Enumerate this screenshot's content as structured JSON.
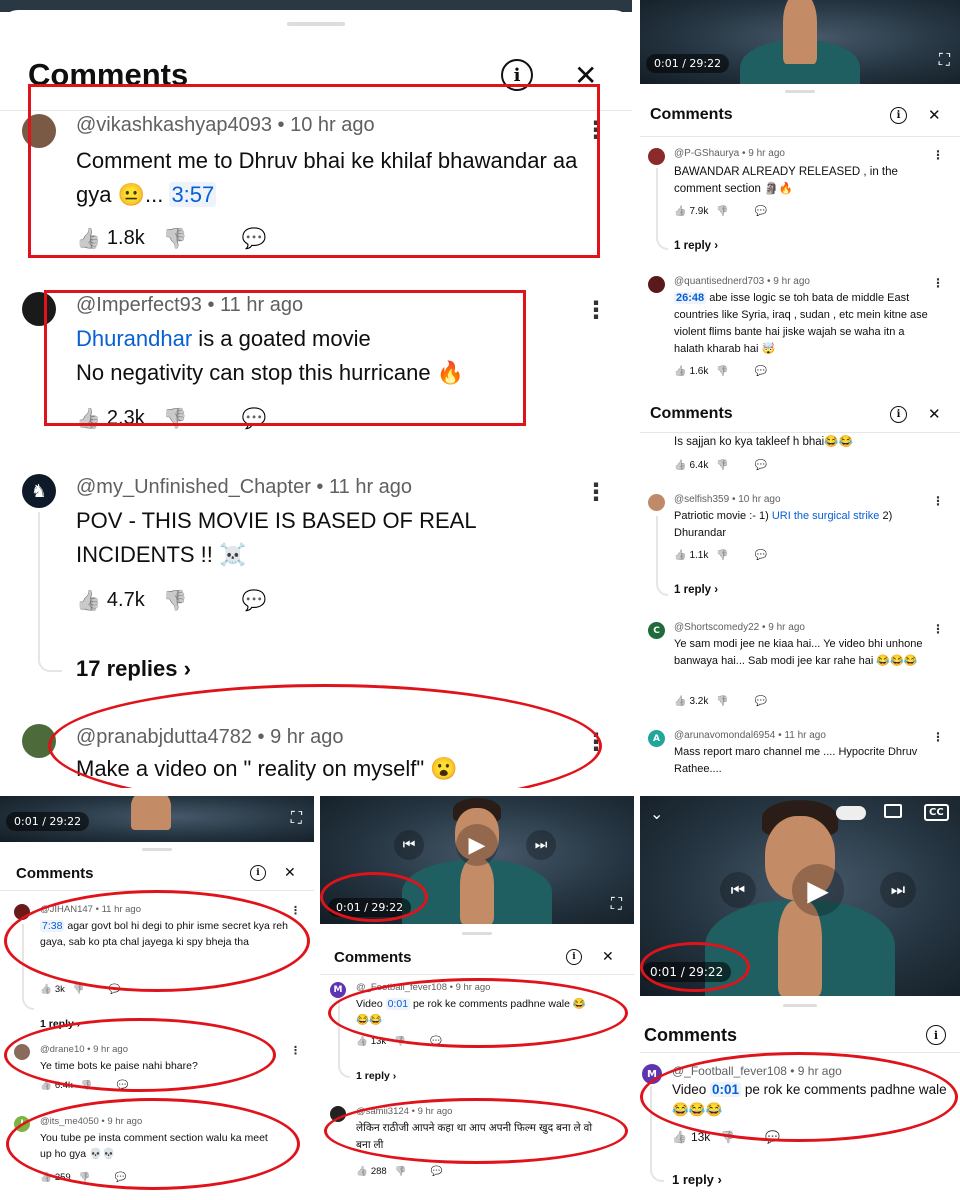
{
  "panel1": {
    "title": "Comments",
    "comments": [
      {
        "handle": "@vikashkashyap4093",
        "time": "10 hr ago",
        "text": "Comment me to Dhruv bhai ke khilaf bhawandar aa gya 😐...",
        "timestamp": "3:57",
        "likes": "1.8k"
      },
      {
        "handle": "@Imperfect93",
        "time": "11 hr ago",
        "link": "Dhurandhar",
        "text1": " is a goated movie",
        "text2": "No negativity can stop this hurricane 🔥",
        "likes": "2.3k"
      },
      {
        "handle": "@my_Unfinished_Chapter",
        "time": "11 hr ago",
        "text": "POV - THIS MOVIE IS BASED OF REAL INCIDENTS !! ☠️",
        "likes": "4.7k",
        "replies": "17 replies"
      },
      {
        "handle": "@pranabjdutta4782",
        "time": "9 hr ago",
        "text": "Make a video on \" reality on myself\" 😮"
      }
    ]
  },
  "panel2": {
    "time": "0:01 / 29:22",
    "title": "Comments",
    "comments": [
      {
        "handle": "@P-GShaurya",
        "time": "9 hr ago",
        "text": "BAWANDAR ALREADY RELEASED , in the comment section 🗿🔥",
        "likes": "7.9k",
        "reply": "1 reply"
      },
      {
        "handle": "@quantisednerd703",
        "time": "9 hr ago",
        "timestamp": "26:48",
        "text": " abe isse logic se toh bata de middle East countries like Syria, iraq , sudan , etc mein kitne ase violent flims bante hai jiske wajah se waha itn a halath kharab hai 🤯",
        "likes": "1.6k"
      }
    ]
  },
  "panel3": {
    "title": "Comments",
    "comments": [
      {
        "handle": "",
        "time": "",
        "text": "Is sajjan ko kya takleef h bhai😂😂",
        "likes": "6.4k"
      },
      {
        "handle": "@selfish359",
        "time": "10 hr ago",
        "text1": "Patriotic movie :- 1) ",
        "link": "URI the surgical strike",
        "text2": " 2) Dhurandar",
        "likes": "1.1k",
        "reply": "1 reply"
      },
      {
        "handle": "@Shortscomedy22",
        "time": "9 hr ago",
        "avatar": "C",
        "text": "Ye sam modi jee ne kiaa hai... Ye video bhi unhone banwaya hai... Sab modi jee kar rahe hai 😂😂😂",
        "likes": "3.2k"
      },
      {
        "handle": "@arunavomondal6954",
        "time": "11 hr ago",
        "avatar": "A",
        "text": "Mass report maro channel me .... Hypocrite Dhruv Rathee...."
      }
    ]
  },
  "panel4": {
    "time": "0:01 / 29:22",
    "title": "Comments",
    "comments": [
      {
        "handle": "@JIHAN147",
        "time": "11 hr ago",
        "timestamp": "7:38",
        "text": " agar govt bol hi degi to phir isme secret kya reh gaya, sab ko pta chal jayega ki spy bheja tha",
        "likes": "3k",
        "reply": "1 reply"
      },
      {
        "handle": "@drane10",
        "time": "9 hr ago",
        "text": "Ye time bots ke paise nahi bhare?",
        "likes": "6.4k"
      },
      {
        "handle": "@its_me4050",
        "time": "9 hr ago",
        "avatar": "I",
        "text": "You tube pe insta comment section walu ka meet up ho gya 💀💀",
        "likes": "259"
      }
    ]
  },
  "panel5": {
    "time": "0:01 / 29:22",
    "title": "Comments",
    "comments": [
      {
        "handle": "@_Football_fever108",
        "time": "9 hr ago",
        "avatar": "M",
        "text1": "Video ",
        "timestamp": "0:01",
        "text2": " pe rok ke comments padhne wale 😂😂😂",
        "likes": "13k",
        "reply": "1 reply"
      },
      {
        "handle": "@samii3124",
        "time": "9 hr ago",
        "text": "लेकिन राठीजी आपने कहा था आप अपनी फिल्म खुद बना ले वो बना ली",
        "likes": "288"
      }
    ]
  },
  "panel6": {
    "time": "0:01 / 29:22",
    "title": "Comments",
    "comments": [
      {
        "handle": "@_Football_fever108",
        "time": "9 hr ago",
        "avatar": "M",
        "text1": "Video ",
        "timestamp": "0:01",
        "text2": " pe rok ke comments padhne wale 😂😂😂",
        "likes": "13k",
        "reply": "1 reply"
      }
    ]
  },
  "icons": {
    "info": "i",
    "close": "✕",
    "like": "👍",
    "dislike": "👎",
    "reply_icon": "💬",
    "kebab": "⋮",
    "fullscreen": "⛶",
    "prev": "⏮",
    "play": "▶",
    "next": "⏭",
    "chevron": "›"
  },
  "colors": {
    "accent_red": "#e0121a",
    "link_blue": "#065fd4"
  }
}
